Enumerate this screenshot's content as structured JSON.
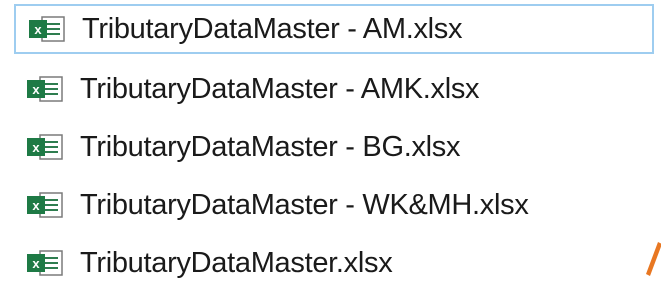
{
  "files": [
    {
      "name": "TributaryDataMaster - AM.xlsx",
      "icon": "excel-file-icon",
      "focused": true
    },
    {
      "name": "TributaryDataMaster - AMK.xlsx",
      "icon": "excel-file-icon",
      "focused": false
    },
    {
      "name": "TributaryDataMaster - BG.xlsx",
      "icon": "excel-file-icon",
      "focused": false
    },
    {
      "name": "TributaryDataMaster - WK&MH.xlsx",
      "icon": "excel-file-icon",
      "focused": false
    },
    {
      "name": "TributaryDataMaster.xlsx",
      "icon": "excel-file-icon",
      "focused": false
    }
  ],
  "colors": {
    "excel_green": "#1e7a45",
    "focus_border": "#9ecdf0",
    "accent_orange": "#e87722"
  }
}
